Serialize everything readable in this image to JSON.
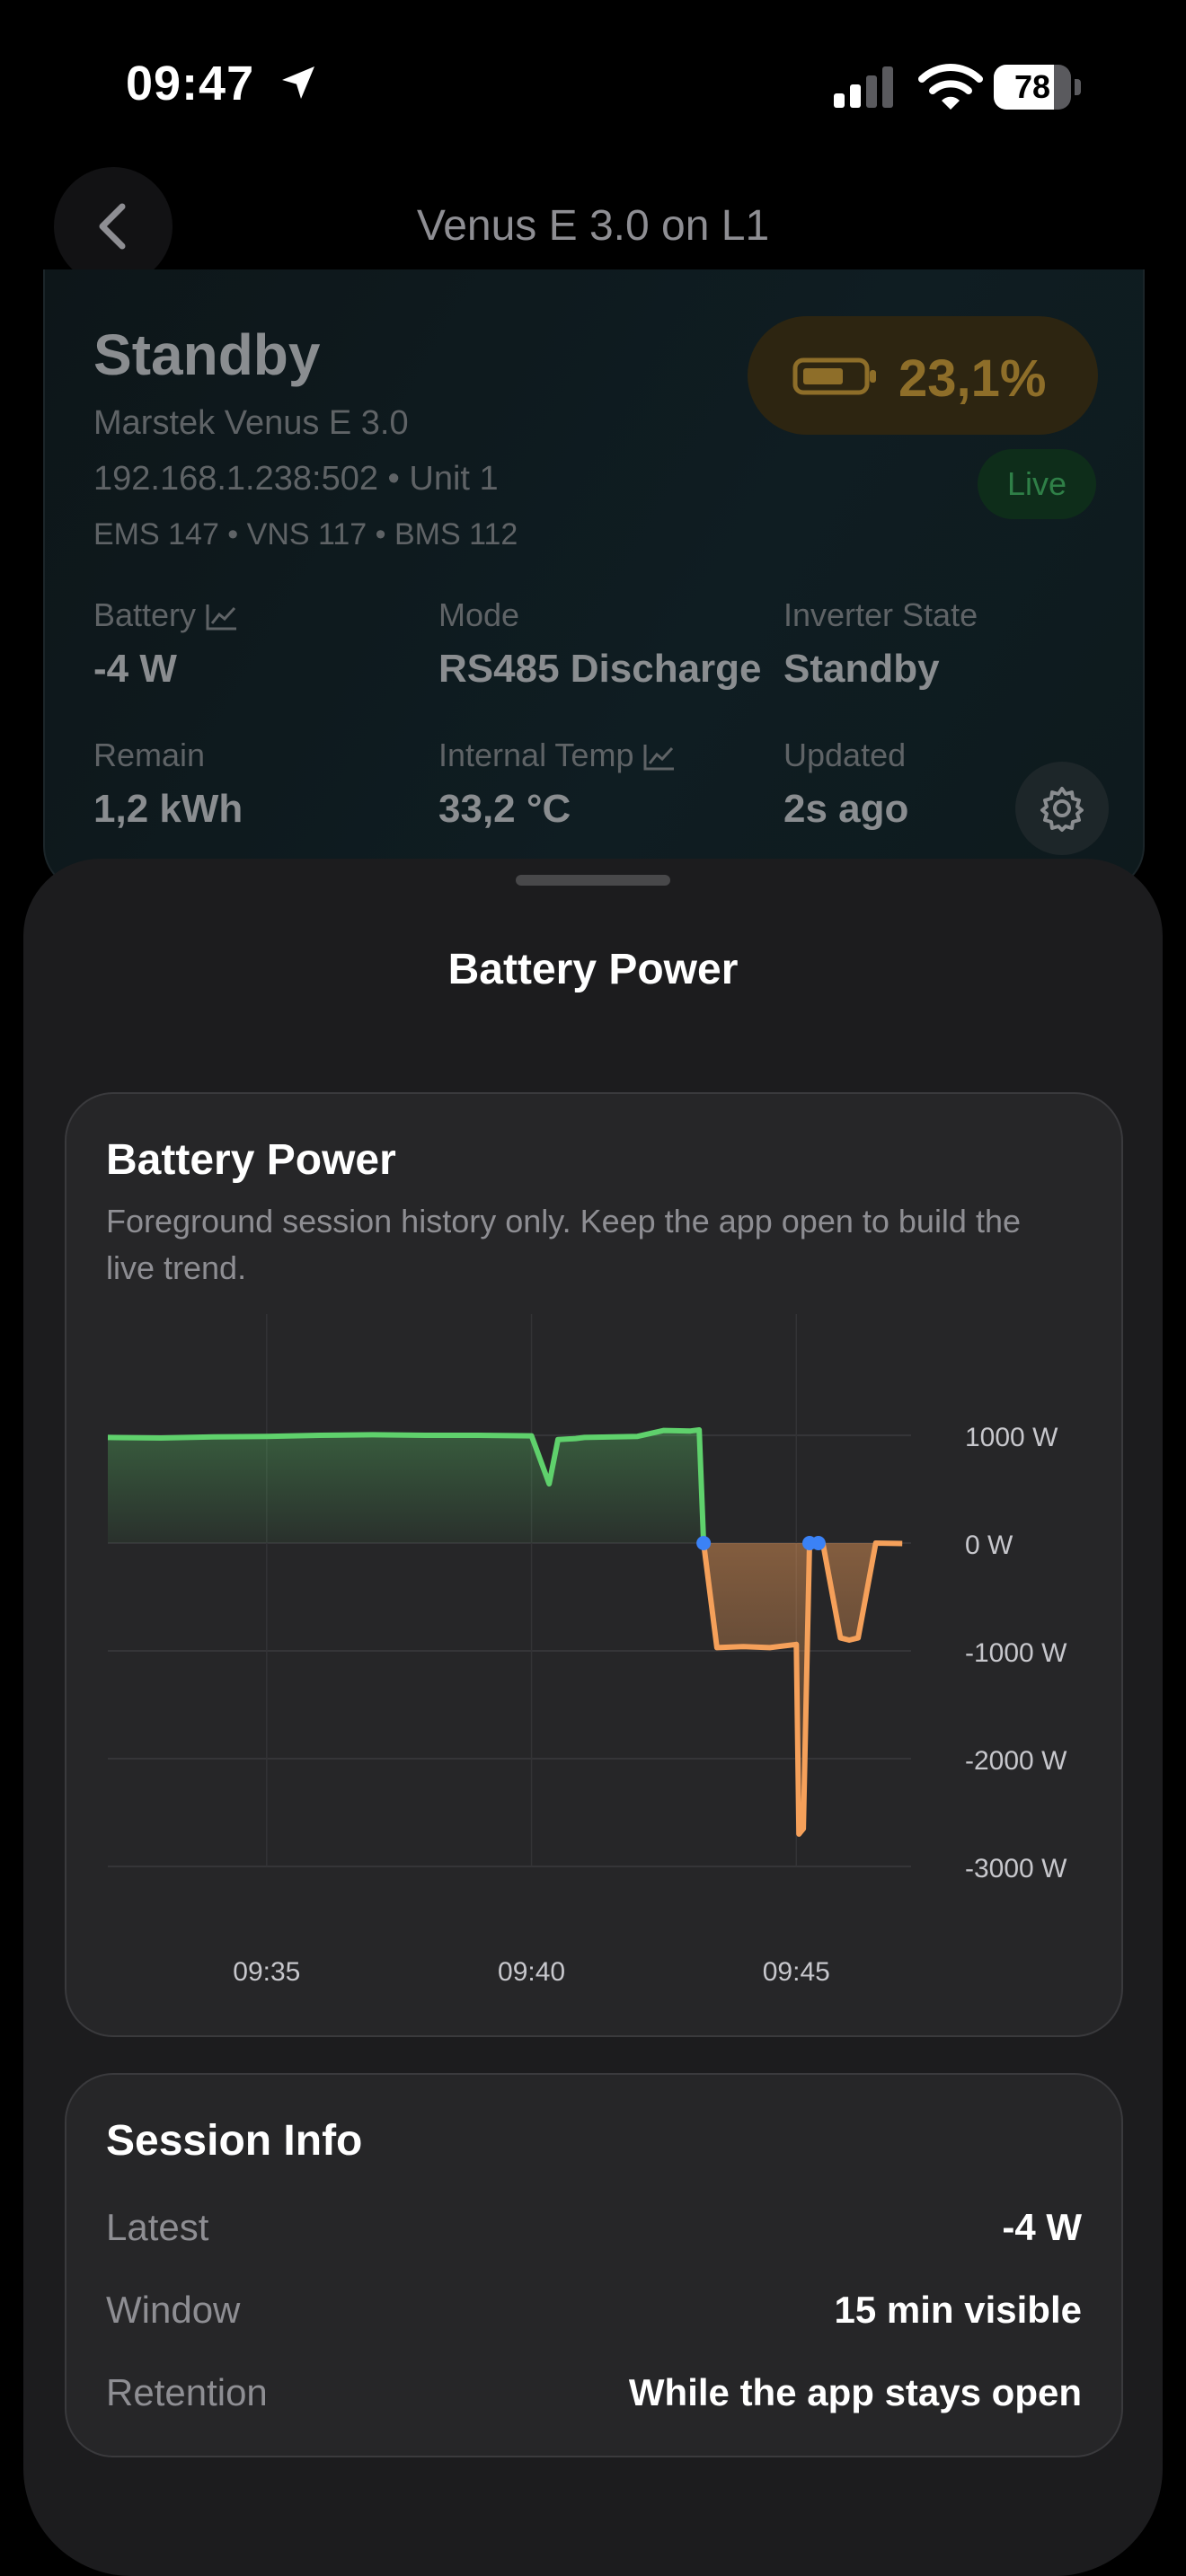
{
  "status_bar": {
    "time": "09:47",
    "battery_level": 78
  },
  "nav": {
    "title": "Venus E 3.0 on L1"
  },
  "device": {
    "state": "Standby",
    "model": "Marstek Venus E 3.0",
    "address": "192.168.1.238:502 • Unit 1",
    "versions": "EMS 147 • VNS 117 • BMS 112",
    "soc": "23,1%",
    "live": "Live",
    "metrics": [
      {
        "label": "Battery",
        "value": "-4 W",
        "trend": true
      },
      {
        "label": "Mode",
        "value": "RS485 Discharge",
        "trend": false
      },
      {
        "label": "Inverter State",
        "value": "Standby",
        "trend": false
      },
      {
        "label": "Remain",
        "value": "1,2 kWh",
        "trend": false
      },
      {
        "label": "Internal Temp",
        "value": "33,2 °C",
        "trend": true
      },
      {
        "label": "Updated",
        "value": "2s ago",
        "trend": false
      }
    ]
  },
  "sheet": {
    "title": "Battery Power"
  },
  "chart_panel": {
    "title": "Battery Power",
    "subtitle": "Foreground session history only. Keep the app open to build the live trend."
  },
  "chart_data": {
    "type": "line",
    "x_unit": "time",
    "x_ticks": [
      "09:35",
      "09:40",
      "09:45"
    ],
    "y_ticks": [
      "1000 W",
      "0 W",
      "-1000 W",
      "-2000 W",
      "-3000 W"
    ],
    "ylim": [
      -3000,
      1000
    ],
    "grid": true,
    "colors": {
      "positive": "#5fd16c",
      "negative": "#f5a05a",
      "marker": "#3b82f6"
    },
    "series": [
      {
        "x": [
          "09:32:00",
          "09:33:00",
          "09:34:00",
          "09:35:00",
          "09:36:00",
          "09:37:00",
          "09:38:00",
          "09:39:00",
          "09:40:00",
          "09:40:20",
          "09:40:30",
          "09:40:50",
          "09:41:00",
          "09:42:00",
          "09:42:30",
          "09:43:00",
          "09:43:10",
          "09:43:15",
          "09:43:30",
          "09:44:00",
          "09:44:30",
          "09:45:00",
          "09:45:03",
          "09:45:08",
          "09:45:15",
          "09:45:30",
          "09:45:50",
          "09:46:00",
          "09:46:10",
          "09:46:30",
          "09:47:00"
        ],
        "y": [
          980,
          975,
          985,
          990,
          1000,
          1005,
          1000,
          1000,
          995,
          550,
          960,
          970,
          980,
          990,
          1045,
          1040,
          1050,
          0,
          -970,
          -960,
          -970,
          -940,
          -2700,
          -2650,
          0,
          0,
          -880,
          -900,
          -880,
          0,
          -4
        ]
      }
    ],
    "markers": [
      {
        "x": "09:43:15",
        "y": 0
      },
      {
        "x": "09:45:15",
        "y": 0
      },
      {
        "x": "09:45:25",
        "y": 0
      }
    ]
  },
  "session_info": {
    "title": "Session Info",
    "rows": [
      {
        "label": "Latest",
        "value": "-4 W"
      },
      {
        "label": "Window",
        "value": "15 min visible"
      },
      {
        "label": "Retention",
        "value": "While the app stays open"
      }
    ]
  }
}
